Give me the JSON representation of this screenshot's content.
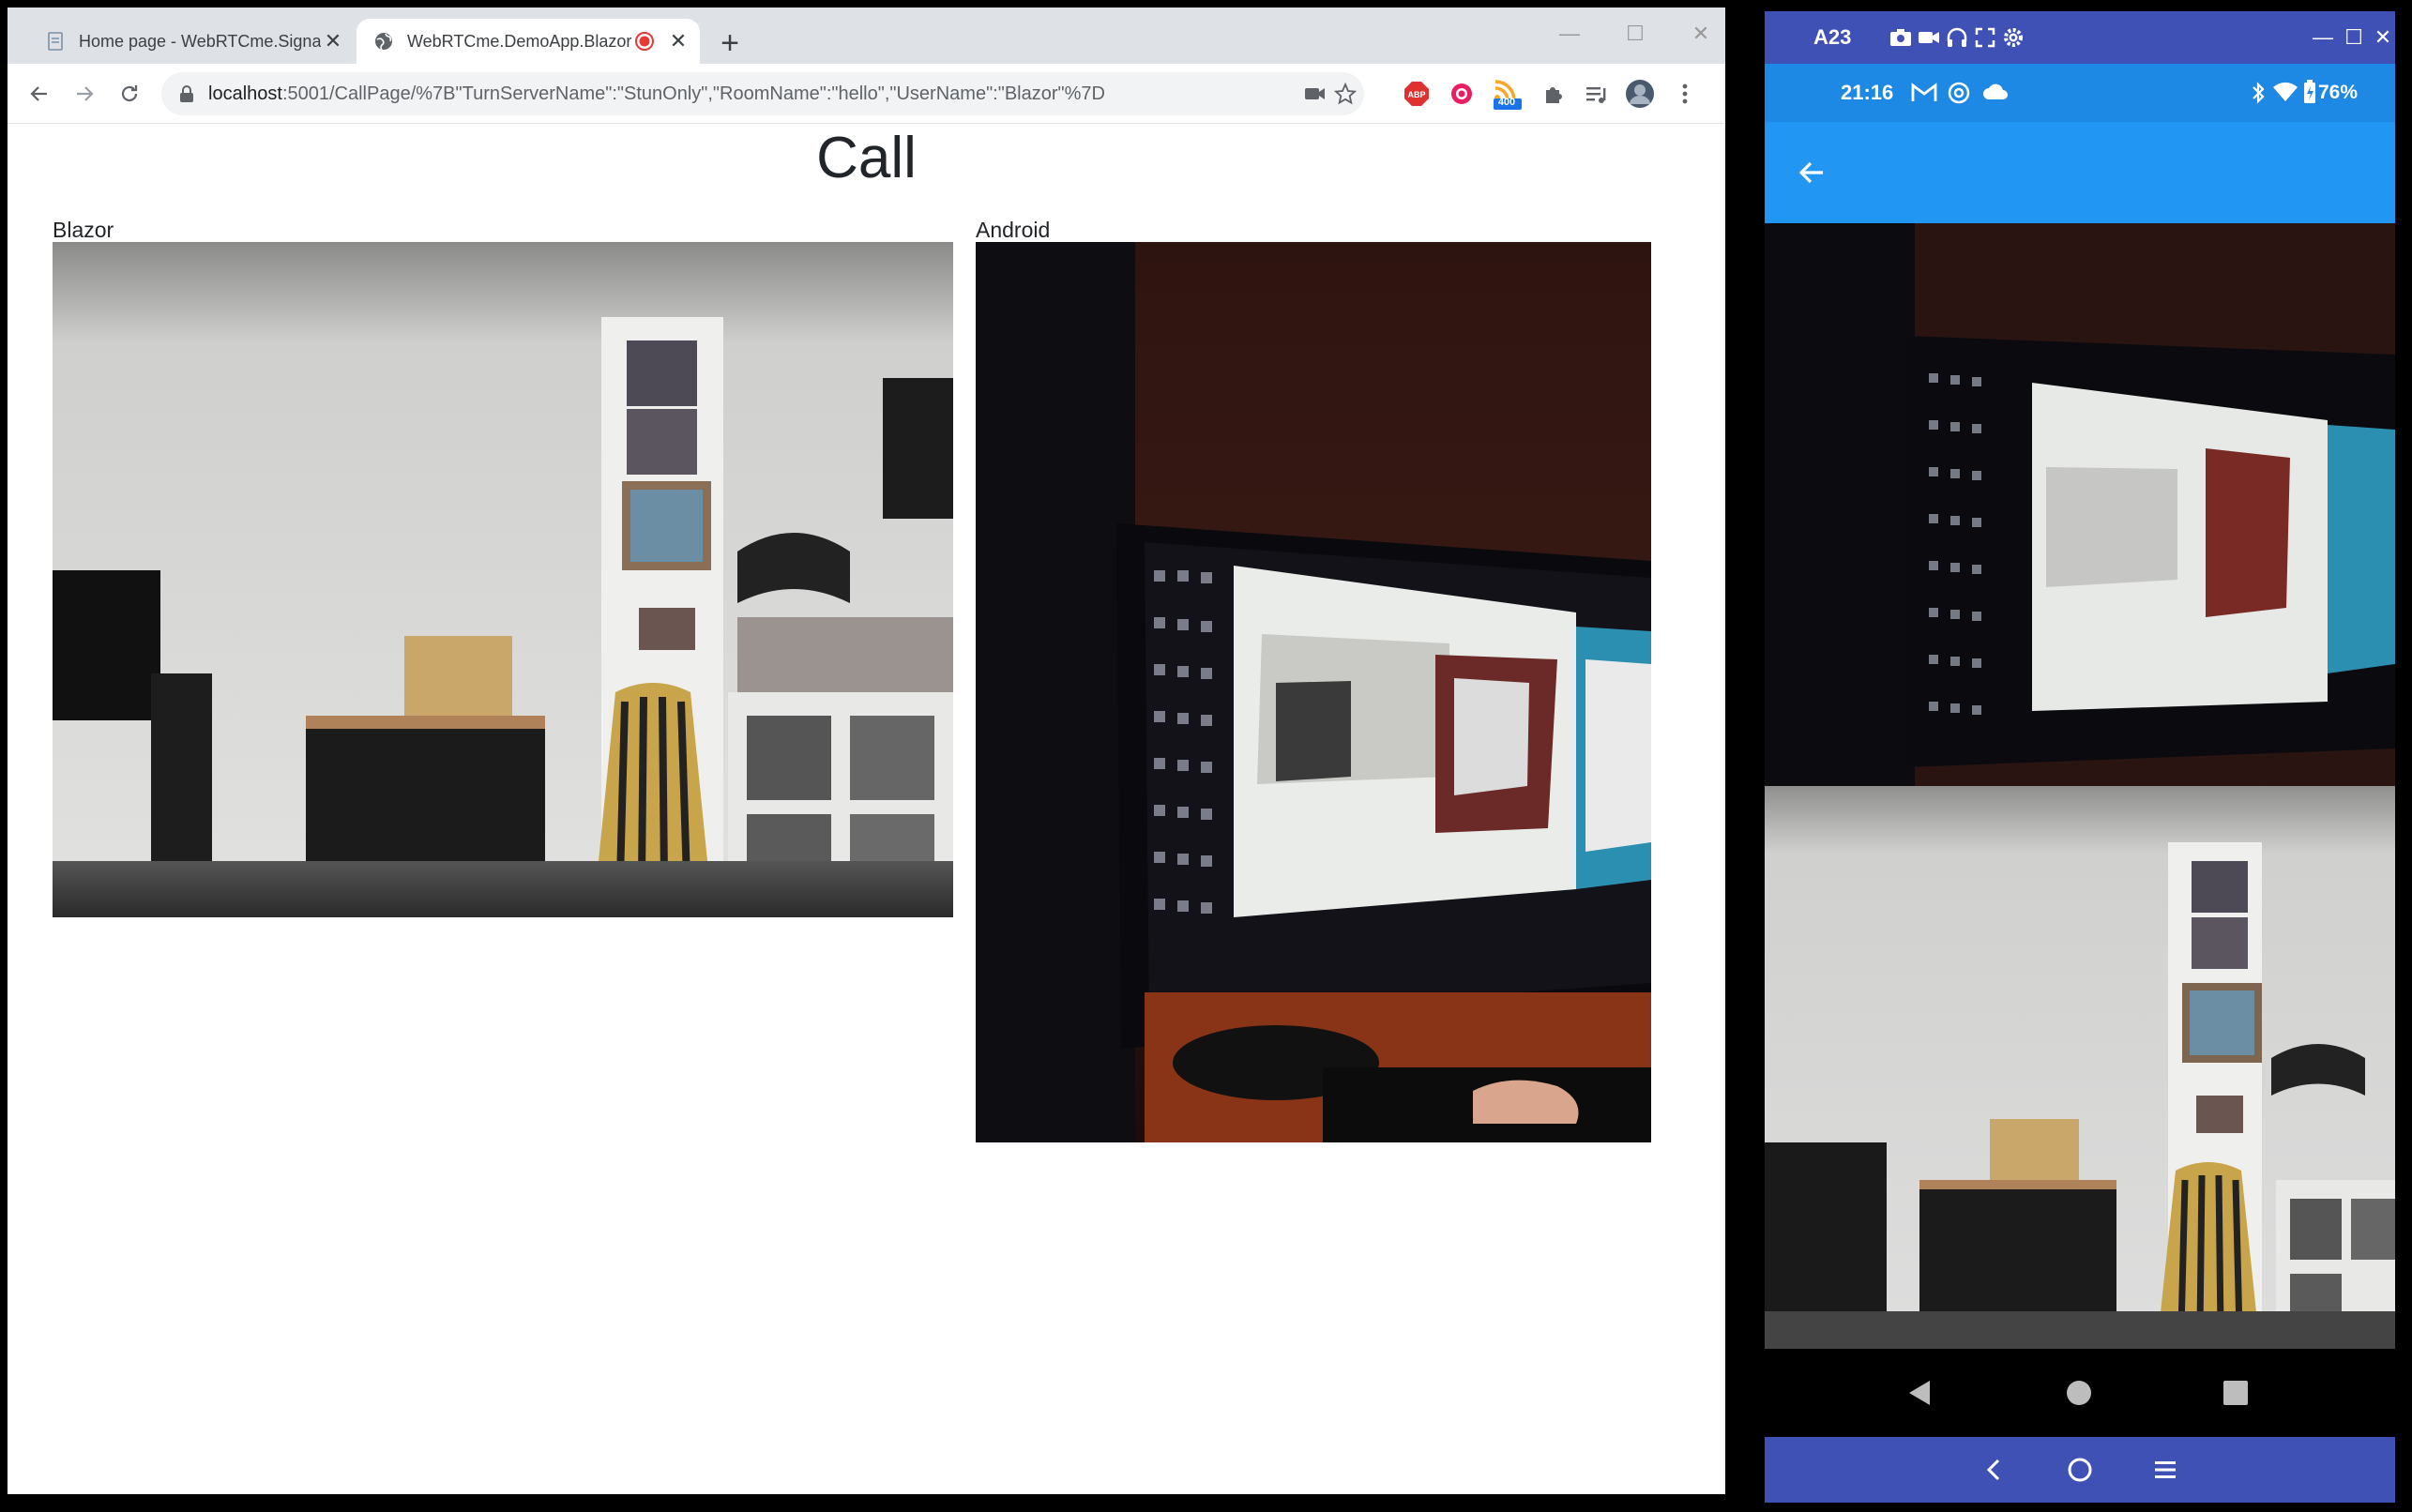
{
  "browser": {
    "tabs": [
      {
        "title": "Home page - WebRTCme.SignalR...",
        "active": false
      },
      {
        "title": "WebRTCme.DemoApp.Blazor",
        "active": true
      }
    ],
    "url_host": "localhost",
    "url_rest": ":5001/CallPage/%7B\"TurnServerName\":\"StunOnly\",\"RoomName\":\"hello\",\"UserName\":\"Blazor\"%7D",
    "extension_badge": "400"
  },
  "page": {
    "title": "Call",
    "videos": [
      {
        "label": "Blazor"
      },
      {
        "label": "Android"
      }
    ]
  },
  "emulator": {
    "device_name": "A23",
    "status_time": "21:16",
    "battery": "76%"
  },
  "colors": {
    "emulator_frame": "#3f51b5",
    "status_bar": "#1e88e5",
    "app_bar": "#2196f3",
    "record_dot": "#e53935"
  }
}
